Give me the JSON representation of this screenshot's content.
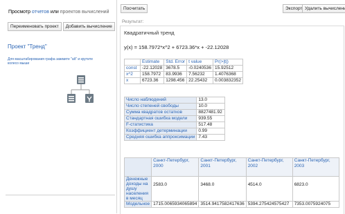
{
  "left": {
    "tab_view": "Просмотр",
    "tab_reports": "отчетов",
    "tab_or": "или",
    "tab_projects": "проектов вычислений",
    "rename_button": "Переименовать проект",
    "add_button": "Добавить вычисление",
    "project_title": "Проект \"Тренд\"",
    "hint": "Для масштабирования графа зажмите \"alt\" и крутите колесо мыши"
  },
  "toolbar": {
    "calc_button": "Посчитать",
    "export_button": "Экспорт",
    "delete_button": "Удалить вычислени"
  },
  "result": {
    "label": "Результат:",
    "title": "Квадратичный тренд",
    "formula": "y(x) = 158.7972*x^2 + 6723.36*x + -22.12028",
    "coef_headers": [
      "",
      "Estimate",
      "Std. Error",
      "t value",
      "Pr(>|t|)"
    ],
    "coef_rows": [
      [
        "const",
        "-22.12028",
        "3678.5",
        "-0.0240536",
        "15.92512"
      ],
      [
        "x^2",
        "158.7972",
        "83.9936",
        "7.56232",
        "1.4076368"
      ],
      [
        "x",
        "6723.36",
        "1298.456",
        "22.25432",
        "0.003832352"
      ]
    ],
    "stats": [
      [
        "Число наблюдений",
        "13.0"
      ],
      [
        "Число степеней свободы",
        "10.0"
      ],
      [
        "Сумма квадратов остатков",
        "8827481.92"
      ],
      [
        "Стандартная ошибка модели",
        "939.55"
      ],
      [
        "F-статистика",
        "517.48"
      ],
      [
        "Коэффициент детерминации",
        "0.99"
      ],
      [
        "Средняя ошибка аппроксимации",
        "7.43"
      ]
    ],
    "city_headers": [
      "Санкт-Петербург, 2000",
      "Санкт-Петербург, 2001",
      "Санкт-Петербург, 2002",
      "Санкт-Петербург, 2003"
    ],
    "income_label": "Денежные доходы на душу населения в месяц",
    "income_values": [
      "2583.0",
      "3468.0",
      "4514.0",
      "6823.0"
    ],
    "model_label": "Модельное",
    "model_values": [
      "1715.0065934065894",
      "3514.9417582417636",
      "5394.275424575427",
      "7353.0075924075"
    ]
  }
}
